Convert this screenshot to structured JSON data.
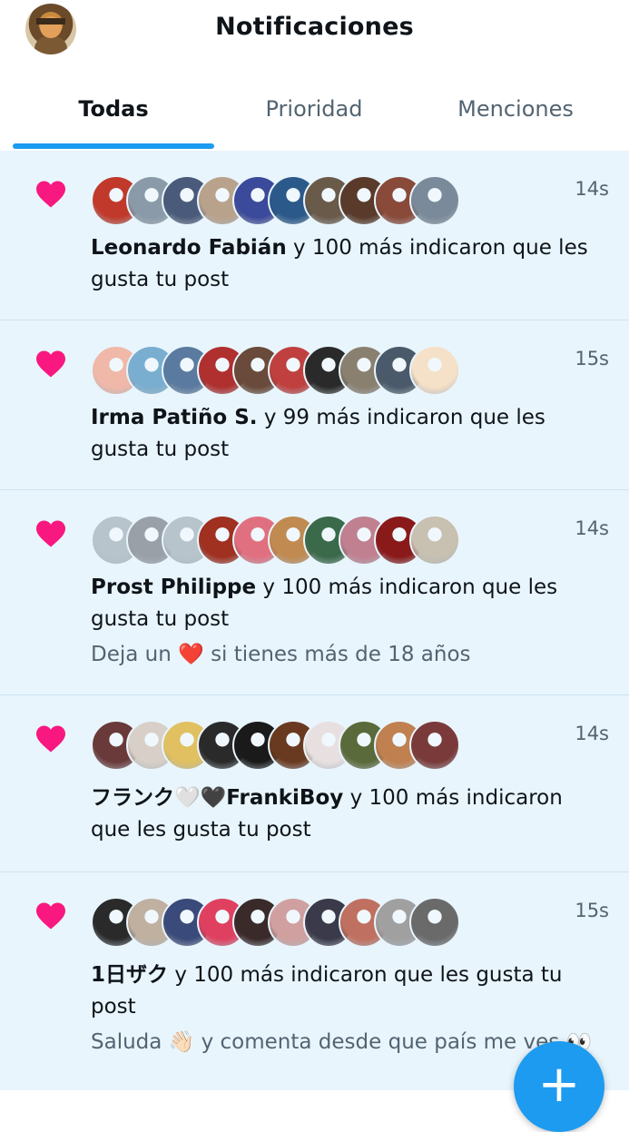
{
  "header": {
    "title": "Notificaciones"
  },
  "tabs": [
    {
      "label": "Todas",
      "active": true
    },
    {
      "label": "Prioridad",
      "active": false
    },
    {
      "label": "Menciones",
      "active": false
    }
  ],
  "notifications": [
    {
      "time": "14s",
      "name": "Leonardo Fabián",
      "action": " y 100 más indicaron que les gusta tu post",
      "subtext": "",
      "avatar_colors": [
        "#c0392b",
        "#8a9aa8",
        "#4a5a7a",
        "#b8a28c",
        "#3b4a9a",
        "#2b5a8a",
        "#6a5a4a",
        "#5a3a2a",
        "#8a4a3a",
        "#7a8a9a"
      ]
    },
    {
      "time": "15s",
      "name": "Irma Patiño S.",
      "action": " y 99 más indicaron que les gusta tu post",
      "subtext": "",
      "avatar_colors": [
        "#f0b8a8",
        "#7aaed0",
        "#5a7aa0",
        "#b03030",
        "#6a4a3a",
        "#c04040",
        "#2a2a2a",
        "#8a8070",
        "#4a5a6a",
        "#f5e0c8"
      ]
    },
    {
      "time": "14s",
      "name": "Prost Philippe",
      "action": " y 100 más indicaron que les gusta tu post",
      "subtext": "Deja un ❤️ si tienes más de 18 años",
      "avatar_colors": [
        "#b8c4cc",
        "#9aa0a8",
        "#b8c4cc",
        "#a03020",
        "#e07080",
        "#c08a50",
        "#3a6a4a",
        "#c08090",
        "#8a1a1a",
        "#c8c0b0"
      ]
    },
    {
      "time": "14s",
      "name": "フランク🤍🖤FrankiBoy",
      "action": " y 100 más indicaron que les gusta tu post",
      "subtext": "",
      "avatar_colors": [
        "#6a3a3a",
        "#d8d0c8",
        "#e0c060",
        "#2a2a2a",
        "#1a1a1a",
        "#6a3a20",
        "#e8e0e0",
        "#5a6a3a",
        "#c08050",
        "#7a3a3a"
      ]
    },
    {
      "time": "15s",
      "name": "1日ザク",
      "action": " y 100 más indicaron que les gusta tu post",
      "subtext": "Saluda 👋🏻 y comenta desde que país me ves 👀",
      "avatar_colors": [
        "#2a2a2a",
        "#c0b0a0",
        "#3a4a7a",
        "#e04060",
        "#3a2a2a",
        "#d0a0a0",
        "#3a3a4a",
        "#c07060",
        "#a0a0a0",
        "#6a6a6a"
      ]
    }
  ],
  "fab": {
    "icon": "plus-icon"
  },
  "colors": {
    "accent": "#1d9bf0",
    "heart": "#f91880",
    "unread_bg": "#e8f5fd"
  }
}
